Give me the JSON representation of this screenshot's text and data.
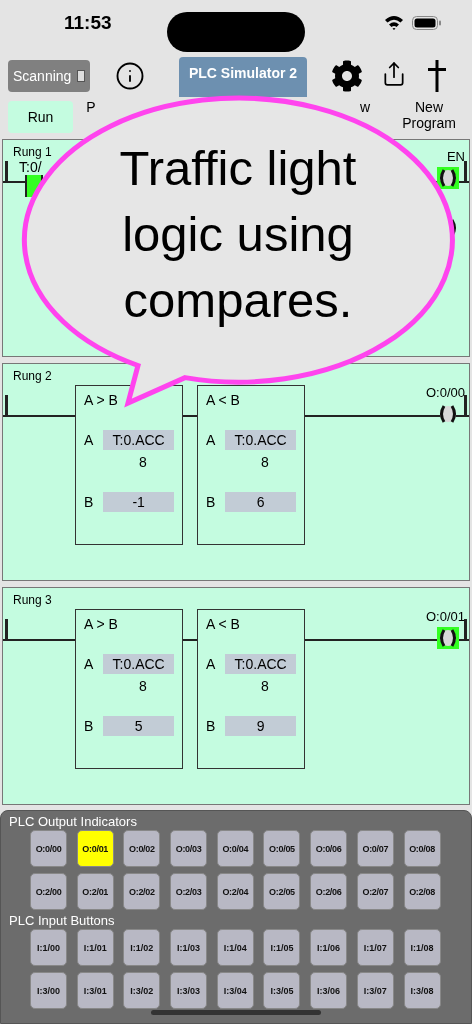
{
  "status_bar": {
    "time": "11:53"
  },
  "toolbar": {
    "scanning": {
      "label": "Scanning",
      "checked": false
    },
    "title": "PLC Simulator 2"
  },
  "tabs": [
    {
      "label": "Run",
      "selected": true
    },
    {
      "label": "P",
      "selected": false
    },
    {
      "label": "w",
      "selected": false
    },
    {
      "label": "New Program",
      "selected": false
    }
  ],
  "rungs": [
    {
      "kind": "contacts",
      "title": "Rung 1",
      "contact": {
        "label": "T:0/",
        "energized": true
      },
      "outputs": [
        {
          "label": "EN",
          "energized": true
        },
        {
          "energized": false
        }
      ]
    },
    {
      "kind": "compare",
      "title": "Rung 2",
      "compares": [
        {
          "title": "A > B",
          "a_label": "A",
          "a_source": "T:0.ACC",
          "a_value": "8",
          "b_label": "B",
          "b_value": "-1"
        },
        {
          "title": "A < B",
          "a_label": "A",
          "a_source": "T:0.ACC",
          "a_value": "8",
          "b_label": "B",
          "b_value": "6"
        }
      ],
      "outputs": [
        {
          "label": "O:0/00",
          "energized": false
        }
      ]
    },
    {
      "kind": "compare",
      "title": "Rung 3",
      "compares": [
        {
          "title": "A > B",
          "a_label": "A",
          "a_source": "T:0.ACC",
          "a_value": "8",
          "b_label": "B",
          "b_value": "5"
        },
        {
          "title": "A < B",
          "a_label": "A",
          "a_source": "T:0.ACC",
          "a_value": "8",
          "b_label": "B",
          "b_value": "9"
        }
      ],
      "outputs": [
        {
          "label": "O:0/01",
          "energized": true
        }
      ]
    }
  ],
  "callout": {
    "text": "Traffic light logic using compares."
  },
  "io_panel": {
    "output_title": "PLC Output Indicators",
    "outputs": [
      {
        "label": "O:0/00",
        "on": false
      },
      {
        "label": "O:0/01",
        "on": true
      },
      {
        "label": "O:0/02",
        "on": false
      },
      {
        "label": "O:0/03",
        "on": false
      },
      {
        "label": "O:0/04",
        "on": false
      },
      {
        "label": "O:0/05",
        "on": false
      },
      {
        "label": "O:0/06",
        "on": false
      },
      {
        "label": "O:0/07",
        "on": false
      },
      {
        "label": "O:0/08",
        "on": false
      },
      {
        "label": "O:2/00",
        "on": false
      },
      {
        "label": "O:2/01",
        "on": false
      },
      {
        "label": "O:2/02",
        "on": false
      },
      {
        "label": "O:2/03",
        "on": false
      },
      {
        "label": "O:2/04",
        "on": false
      },
      {
        "label": "O:2/05",
        "on": false
      },
      {
        "label": "O:2/06",
        "on": false
      },
      {
        "label": "O:2/07",
        "on": false
      },
      {
        "label": "O:2/08",
        "on": false
      }
    ],
    "input_title": "PLC Input Buttons",
    "inputs": [
      "I:1/00",
      "I:1/01",
      "I:1/02",
      "I:1/03",
      "I:1/04",
      "I:1/05",
      "I:1/06",
      "I:1/07",
      "I:1/08",
      "I:3/00",
      "I:3/01",
      "I:3/02",
      "I:3/03",
      "I:3/04",
      "I:3/05",
      "I:3/06",
      "I:3/07",
      "I:3/08"
    ]
  }
}
